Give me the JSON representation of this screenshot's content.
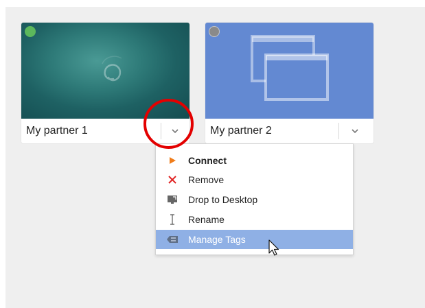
{
  "partners": [
    {
      "name": "My partner 1",
      "status_color": "#5cb85c",
      "thumbnail": "desktop-wallpaper"
    },
    {
      "name": "My partner 2",
      "status_color": "#888888",
      "thumbnail": "window-icon"
    }
  ],
  "context_menu": {
    "items": [
      {
        "label": "Connect",
        "icon": "play-icon",
        "bold": true
      },
      {
        "label": "Remove",
        "icon": "close-icon"
      },
      {
        "label": "Drop to Desktop",
        "icon": "desktop-icon"
      },
      {
        "label": "Rename",
        "icon": "text-cursor-icon"
      },
      {
        "label": "Manage Tags",
        "icon": "tag-icon",
        "highlighted": true
      }
    ]
  },
  "colors": {
    "accent_highlight": "#8fb0e5",
    "annotation_circle": "#e30000",
    "connect_icon": "#f07d1b",
    "remove_icon": "#e02020"
  }
}
